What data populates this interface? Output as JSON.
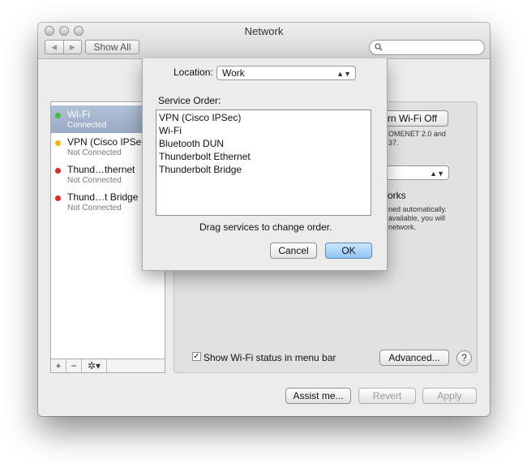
{
  "window": {
    "title": "Network"
  },
  "toolbar": {
    "back_label": "◀",
    "forward_label": "▶",
    "show_all_label": "Show All",
    "search_placeholder": ""
  },
  "sidebar": {
    "services": [
      {
        "name": "Wi-Fi",
        "status": "Connected",
        "indicator": "#3fbf3a"
      },
      {
        "name": "VPN (Cisco IPSec)",
        "status": "Not Connected",
        "indicator": "#f2b31f"
      },
      {
        "name": "Thund…thernet",
        "status": "Not Connected",
        "indicator": "#d92b2b"
      },
      {
        "name": "Thund…t Bridge",
        "status": "Not Connected",
        "indicator": "#d92b2b"
      }
    ],
    "add_label": "+",
    "remove_label": "−",
    "action_label": "✲▾"
  },
  "main": {
    "turn_wifi_off_label": "rn Wi-Fi Off",
    "status_text_1": "OMENET 2.0 and",
    "status_text_2": "37.",
    "networks_heading": "orks",
    "info_text_1": "ned automatically.",
    "info_text_2": "available, you will",
    "info_text_3": "network.",
    "show_status_label": "Show Wi-Fi status in menu bar",
    "show_status_checked": "✓",
    "advanced_label": "Advanced...",
    "help_label": "?"
  },
  "footer": {
    "assist_label": "Assist me...",
    "revert_label": "Revert",
    "apply_label": "Apply"
  },
  "sheet": {
    "location_label": "Location:",
    "location_value": "Work",
    "service_order_label": "Service Order:",
    "services": [
      "VPN (Cisco IPSec)",
      "Wi-Fi",
      "Bluetooth DUN",
      "Thunderbolt Ethernet",
      "Thunderbolt Bridge"
    ],
    "hint": "Drag services to change order.",
    "cancel_label": "Cancel",
    "ok_label": "OK"
  },
  "colors": {
    "selection": "#a7b8d0",
    "ok_button": "#8fc4f4"
  }
}
